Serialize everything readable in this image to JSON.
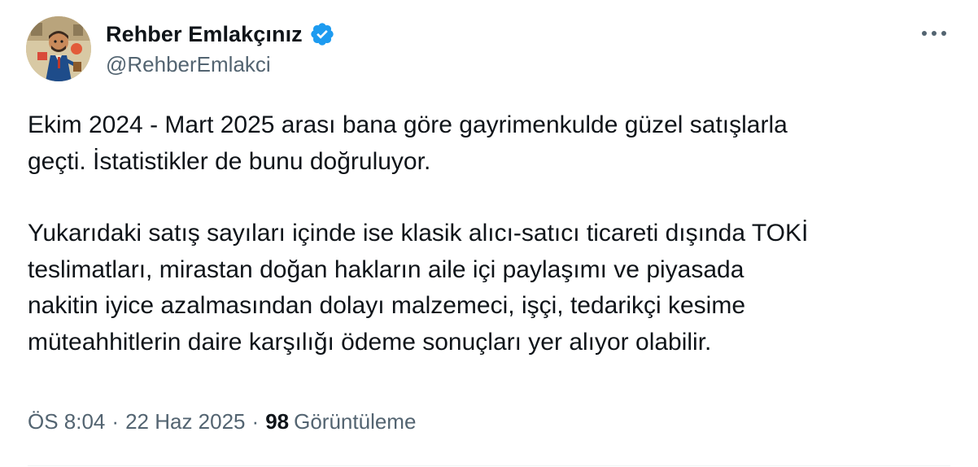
{
  "author": {
    "display_name": "Rehber Emlakçınız",
    "handle": "@RehberEmlakci",
    "verified_color": "#1d9bf0"
  },
  "tweet": {
    "lines_p1": [
      "Ekim 2024 - Mart 2025 arası bana göre gayrimenkulde güzel satışlarla",
      "geçti. İstatistikler de bunu doğruluyor."
    ],
    "lines_p2": [
      "Yukarıdaki satış sayıları içinde ise klasik alıcı-satıcı ticareti dışında TOKİ",
      "teslimatları, mirastan doğan hakların aile içi paylaşımı ve piyasada",
      "nakitin iyice azalmasından dolayı malzemeci, işçi, tedarikçi kesime",
      "müteahhitlerin daire karşılığı ödeme sonuçları yer alıyor olabilir."
    ]
  },
  "meta": {
    "time": "ÖS 8:04",
    "separator": "·",
    "date": "22 Haz 2025",
    "views_count": "98",
    "views_label": "Görüntüleme"
  },
  "icons": {
    "more": "more-horizontal-icon",
    "verified": "verified-badge-icon"
  }
}
